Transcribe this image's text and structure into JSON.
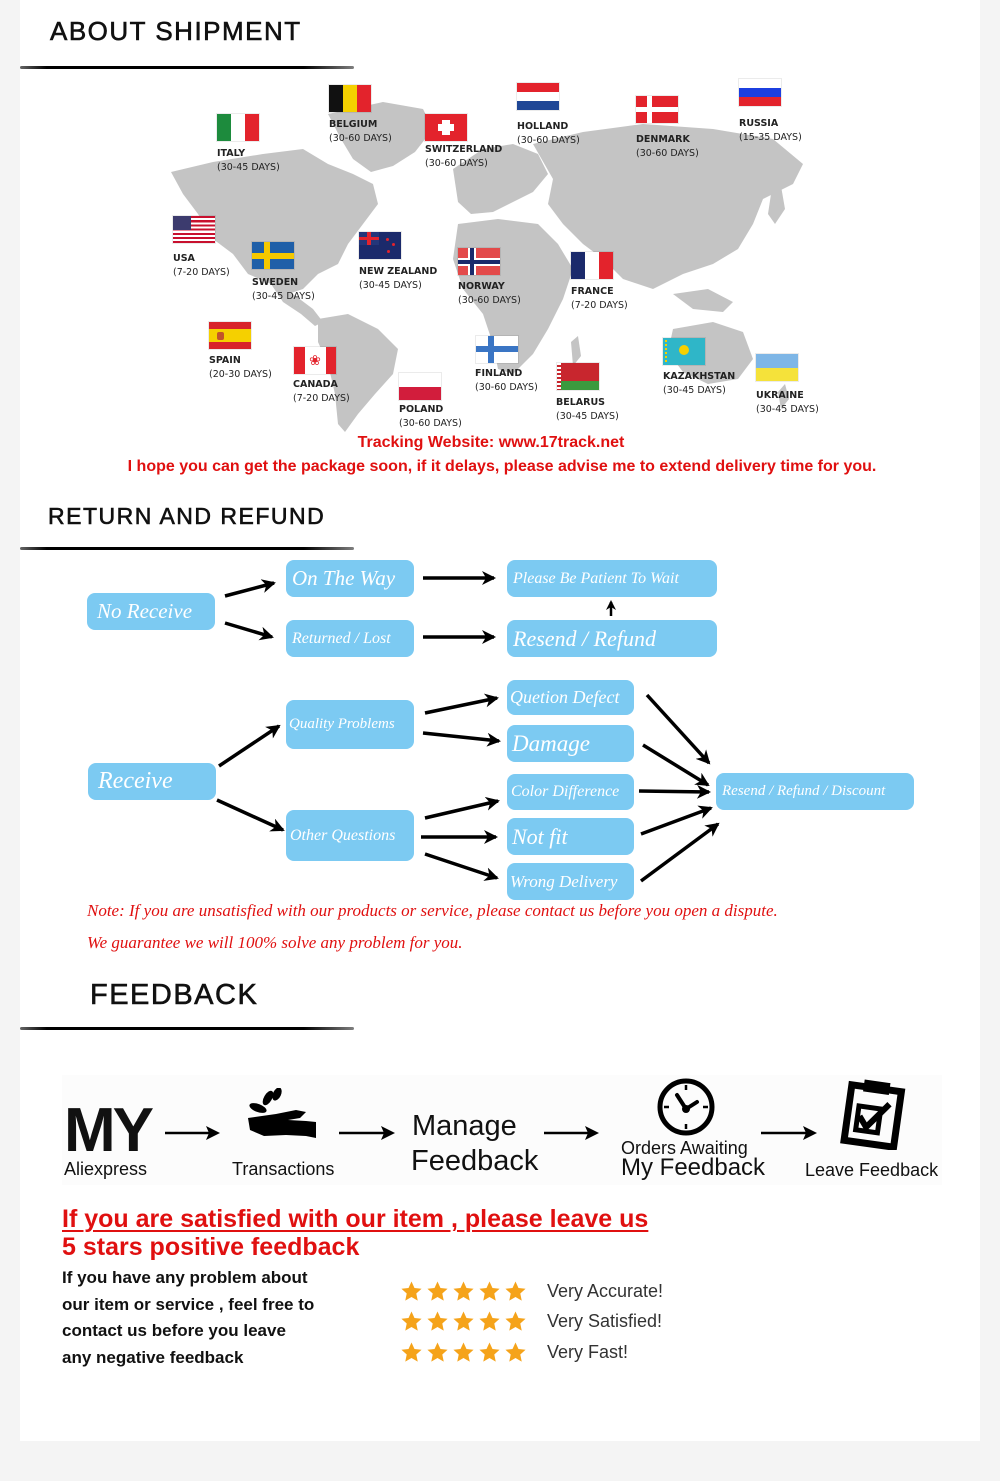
{
  "colors": {
    "accent_red": "#e01010",
    "box_blue": "#7ccaf2",
    "star_orange": "#f5a31a",
    "map_gray": "#c2c2c2"
  },
  "shipment": {
    "title": "ABOUT  SHIPMENT",
    "countries": [
      {
        "name": "ITALY",
        "days": "(30-45 DAYS)",
        "flag": "italy-flag"
      },
      {
        "name": "BELGIUM",
        "days": "(30-60 DAYS)",
        "flag": "belgium-flag"
      },
      {
        "name": "SWITZERLAND",
        "days": "(30-60 DAYS)",
        "flag": "switzerland-flag"
      },
      {
        "name": "HOLLAND",
        "days": "(30-60 DAYS)",
        "flag": "holland-flag"
      },
      {
        "name": "DENMARK",
        "days": "(30-60 DAYS)",
        "flag": "denmark-flag"
      },
      {
        "name": "RUSSIA",
        "days": "(15-35 DAYS)",
        "flag": "russia-flag"
      },
      {
        "name": "USA",
        "days": "(7-20 DAYS)",
        "flag": "usa-flag"
      },
      {
        "name": "SWEDEN",
        "days": "(30-45 DAYS)",
        "flag": "sweden-flag"
      },
      {
        "name": "NEW ZEALAND",
        "days": "(30-45 DAYS)",
        "flag": "new-zealand-flag"
      },
      {
        "name": "NORWAY",
        "days": "(30-60 DAYS)",
        "flag": "norway-flag"
      },
      {
        "name": "FRANCE",
        "days": "(7-20 DAYS)",
        "flag": "france-flag"
      },
      {
        "name": "SPAIN",
        "days": "(20-30 DAYS)",
        "flag": "spain-flag"
      },
      {
        "name": "CANADA",
        "days": "(7-20 DAYS)",
        "flag": "canada-flag"
      },
      {
        "name": "POLAND",
        "days": "(30-60 DAYS)",
        "flag": "poland-flag"
      },
      {
        "name": "FINLAND",
        "days": "(30-60 DAYS)",
        "flag": "finland-flag"
      },
      {
        "name": "BELARUS",
        "days": "(30-45 DAYS)",
        "flag": "belarus-flag"
      },
      {
        "name": "KAZAKHSTAN",
        "days": "(30-45 DAYS)",
        "flag": "kazakhstan-flag"
      },
      {
        "name": "UKRAINE",
        "days": "(30-45 DAYS)",
        "flag": "ukraine-flag"
      }
    ],
    "tracking": "Tracking Website: www.17track.net",
    "hope": "I hope you can get the package soon, if it delays, please advise me to extend delivery time for you."
  },
  "refund": {
    "title": "RETURN  AND  REFUND",
    "no_receive": "No Receive",
    "on_the_way": "On The Way",
    "returned_lost": "Returned / Lost",
    "be_patient": "Please Be Patient To Wait",
    "resend_refund": "Resend / Refund",
    "receive": "Receive",
    "quality_problems": "Quality Problems",
    "other_questions": "Other Questions",
    "question_defect": "Quetion Defect",
    "damage": "Damage",
    "color_difference": "Color Difference",
    "not_fit": "Not fit",
    "wrong_delivery": "Wrong Delivery",
    "resend_refund_discount": "Resend / Refund / Discount",
    "note1": "Note: If you are unsatisfied with our products or service, please contact us before you open a dispute.",
    "note2": "We guarantee we will 100% solve any problem for you."
  },
  "feedback": {
    "title": "FEEDBACK",
    "steps": {
      "my": "MY",
      "aliexpress": "Aliexpress",
      "transactions": "Transactions",
      "manage": "Manage",
      "feedback": "Feedback",
      "orders_awaiting": "Orders Awaiting",
      "my_feedback": "My Feedback",
      "leave_feedback": "Leave Feedback"
    },
    "headline1": "If you are satisfied with our item , please leave us",
    "headline2": "5 stars positive feedback",
    "para": [
      "If you have any problem about",
      "our item or service , feel free to",
      "contact us before you  leave",
      "any negative feedback"
    ],
    "ratings": [
      {
        "stars": 5,
        "text": "Very Accurate!"
      },
      {
        "stars": 5,
        "text": "Very Satisfied!"
      },
      {
        "stars": 5,
        "text": "Very Fast!"
      }
    ]
  }
}
